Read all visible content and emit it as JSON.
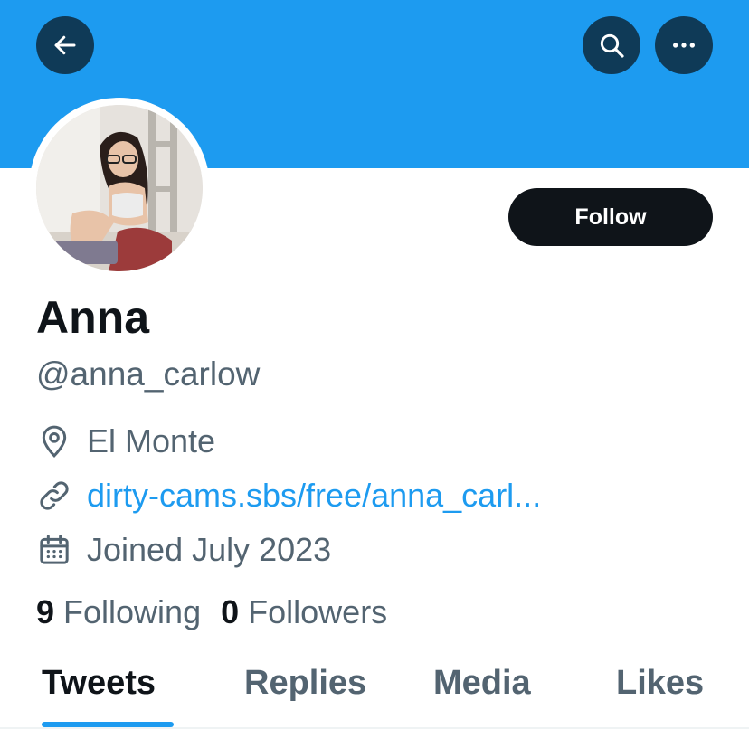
{
  "header": {
    "banner_color": "#1d9bf0",
    "back_icon": "arrow-left-icon",
    "search_icon": "search-icon",
    "more_icon": "more-horizontal-icon"
  },
  "profile": {
    "avatar": "profile-photo",
    "display_name": "Anna",
    "handle": "@anna_carlow",
    "follow_label": "Follow",
    "location": "El Monte",
    "location_icon": "location-pin-icon",
    "link": "dirty-cams.sbs/free/anna_carl...",
    "link_icon": "link-icon",
    "joined": "Joined July 2023",
    "joined_icon": "calendar-icon",
    "following_count": "9",
    "following_label": "Following",
    "followers_count": "0",
    "followers_label": "Followers"
  },
  "tabs": [
    {
      "label": "Tweets",
      "active": true
    },
    {
      "label": "Replies",
      "active": false
    },
    {
      "label": "Media",
      "active": false
    },
    {
      "label": "Likes",
      "active": false
    }
  ],
  "colors": {
    "accent": "#1d9bf0",
    "text_primary": "#0f1419",
    "text_secondary": "#536471"
  }
}
